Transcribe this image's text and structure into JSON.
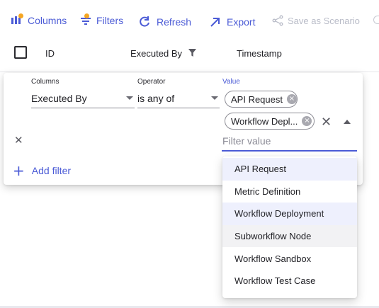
{
  "toolbar": {
    "columns": "Columns",
    "filters": "Filters",
    "refresh": "Refresh",
    "export": "Export",
    "save_scenario": "Save as Scenario"
  },
  "grid": {
    "headers": [
      "ID",
      "Executed By",
      "Timestamp"
    ]
  },
  "filter_panel": {
    "columns_label": "Columns",
    "operator_label": "Operator",
    "value_label": "Value",
    "column_value": "Executed By",
    "operator_value": "is any of",
    "chips": [
      "API Request",
      "Workflow Depl..."
    ],
    "input_placeholder": "Filter value",
    "add_filter": "Add filter"
  },
  "dropdown": {
    "options": [
      "API Request",
      "Metric Definition",
      "Workflow Deployment",
      "Subworkflow Node",
      "Workflow Sandbox",
      "Workflow Test Case"
    ],
    "selected": [
      "API Request",
      "Workflow Deployment"
    ],
    "hovered": "Subworkflow Node"
  },
  "colors": {
    "accent": "#4b5bd6",
    "badge": "#f5a623",
    "disabled": "#b9bcc8"
  },
  "icons": [
    "columns-icon",
    "filter-icon",
    "refresh-icon",
    "export-icon",
    "share-icon",
    "filter-funnel-icon",
    "close-icon",
    "chevron-up-icon",
    "plus-icon"
  ]
}
